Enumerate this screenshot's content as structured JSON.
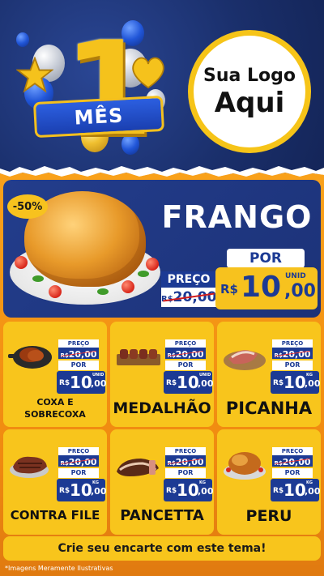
{
  "header": {
    "badge_number": "1",
    "badge_text": "MÊS",
    "logo_line1": "Sua Logo",
    "logo_line2": "Aqui"
  },
  "featured": {
    "discount": "-50%",
    "name": "FRANGO",
    "preco_label": "PREÇO",
    "old_currency": "R$",
    "old_price": "20,00",
    "por_label": "POR",
    "currency": "R$",
    "price_int": "10",
    "price_dec": ",00",
    "unit": "UNID"
  },
  "products": [
    {
      "name_l1": "COXA E",
      "name_l2": "SOBRECOXA",
      "preco": "PREÇO",
      "old_cur": "R$",
      "old": "20,00",
      "por": "POR",
      "cur": "R$",
      "int": "10",
      "dec": ",00",
      "unit": "UNID"
    },
    {
      "name_l1": "MEDALHÃO",
      "preco": "PREÇO",
      "old_cur": "R$",
      "old": "20,00",
      "por": "POR",
      "cur": "R$",
      "int": "10",
      "dec": ",00",
      "unit": "UNID"
    },
    {
      "name_l1": "PICANHA",
      "preco": "PREÇO",
      "old_cur": "R$",
      "old": "20,00",
      "por": "POR",
      "cur": "R$",
      "int": "10",
      "dec": ",00",
      "unit": "KG"
    },
    {
      "name_l1": "CONTRA FILE",
      "preco": "PREÇO",
      "old_cur": "R$",
      "old": "20,00",
      "por": "POR",
      "cur": "R$",
      "int": "10",
      "dec": ",00",
      "unit": "KG"
    },
    {
      "name_l1": "PANCETTA",
      "preco": "PREÇO",
      "old_cur": "R$",
      "old": "20,00",
      "por": "POR",
      "cur": "R$",
      "int": "10",
      "dec": ",00",
      "unit": "KG"
    },
    {
      "name_l1": "PERU",
      "preco": "PREÇO",
      "old_cur": "R$",
      "old": "20,00",
      "por": "POR",
      "cur": "R$",
      "int": "10",
      "dec": ",00",
      "unit": "KG"
    }
  ],
  "footer": {
    "cta": "Crie seu encarte com este tema!",
    "note": "*Imagens Meramente Ilustrativas"
  },
  "colors": {
    "navy": "#1c3a94",
    "yellow": "#f8c51c",
    "orange": "#f39a18",
    "strike_red": "#d21c1c"
  }
}
